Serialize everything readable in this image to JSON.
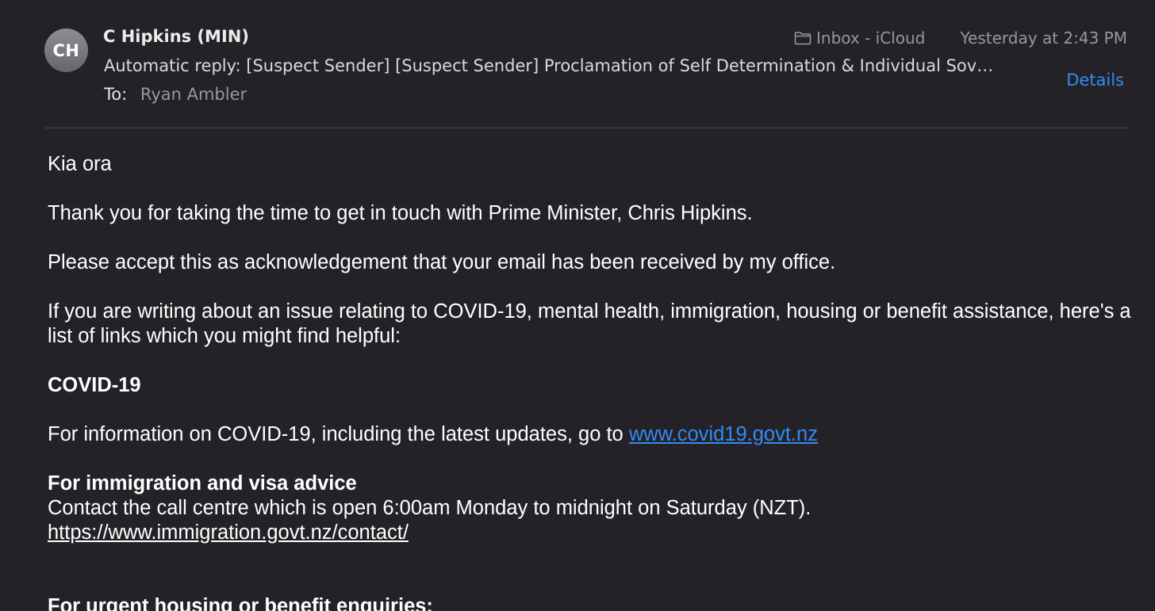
{
  "header": {
    "avatar_initials": "CH",
    "sender": "C Hipkins (MIN)",
    "mailbox": "Inbox - iCloud",
    "date": "Yesterday at 2:43 PM",
    "subject": "Automatic reply: [Suspect Sender] [Suspect Sender] Proclamation of Self Determination & Individual Sov…",
    "details_label": "Details",
    "to_label": "To:",
    "to_name": "Ryan Ambler"
  },
  "body": {
    "greeting": "Kia ora",
    "para1": "Thank you for taking the time to get in touch with Prime Minister, Chris Hipkins.",
    "para2": "Please accept this as acknowledgement that your email has been received by my office.",
    "para3": "If you are writing about an issue relating to COVID-19, mental health, immigration, housing or benefit assistance, here's a list of links which you might find helpful:",
    "covid_heading": "COVID-19",
    "covid_text": "For information on COVID-19, including the latest updates, go to",
    "covid_link": "www.covid19.govt.nz",
    "immigration_heading": "For immigration and visa advice",
    "immigration_text": "Contact the call centre which is open  6:00am Monday to midnight on Saturday (NZT).",
    "immigration_link": "https://www.immigration.govt.nz/contact/",
    "housing_heading": "For urgent housing or benefit enquiries:"
  },
  "colors": {
    "background": "#252227",
    "link": "#2f8cf5",
    "secondary_text": "#98979c"
  },
  "icons": {
    "mailbox": "folder-icon"
  }
}
